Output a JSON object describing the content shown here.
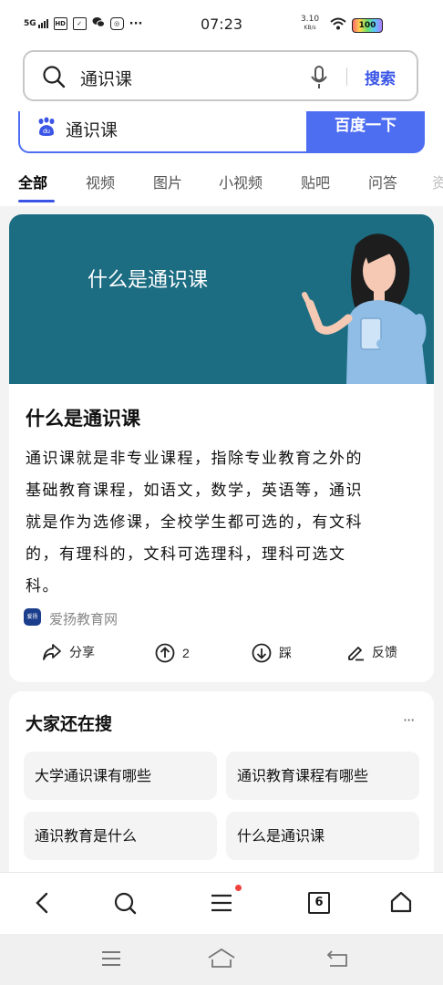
{
  "status_bar": {
    "network": "5G",
    "icons": [
      "signal-icon",
      "hd-icon",
      "check-icon",
      "wechat-icon",
      "message-icon",
      "more-dots-icon"
    ],
    "time": "07:23",
    "speed_value": "3.10",
    "speed_unit": "KB/s",
    "battery": "100"
  },
  "search": {
    "query": "通识课",
    "button": "搜索"
  },
  "baidu": {
    "query": "通识课",
    "button": "百度一下",
    "logo": "du"
  },
  "tabs": [
    "全部",
    "视频",
    "图片",
    "小视频",
    "贴吧",
    "问答",
    "资"
  ],
  "result": {
    "banner_text": "什么是通识课",
    "title": "什么是通识课",
    "body_lines": [
      "通识课就是非专业课程，指除专业教育之外的",
      "基础教育课程，如语文，数学，英语等，通识",
      "就是作为选修课，全校学生都可选的，有文科",
      "的，有理科的，文科可选理科，理科可选文",
      "科。"
    ],
    "source_logo_text": "爱扬",
    "source": "爱扬教育网",
    "actions": {
      "share": "分享",
      "up_count": "2",
      "down": "踩",
      "feedback": "反馈"
    }
  },
  "related": {
    "title": "大家还在搜",
    "more": "···",
    "items": [
      "大学通识课有哪些",
      "通识教育课程有哪些",
      "通识教育是什么",
      "什么是通识课"
    ]
  },
  "bottom_nav": {
    "tab_count": "6"
  },
  "colors": {
    "accent": "#3a55e6",
    "baidu_blue": "#4e6ef2",
    "banner": "#1c6c82",
    "dot": "#f0423c"
  }
}
